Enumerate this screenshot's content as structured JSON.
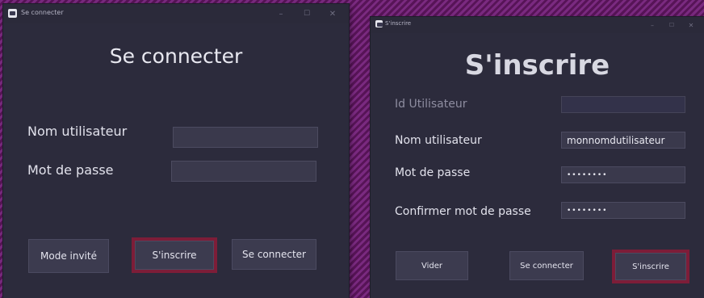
{
  "login_window": {
    "title": "Se connecter",
    "heading": "Se connecter",
    "username_label": "Nom utilisateur",
    "username_value": "",
    "password_label": "Mot de passe",
    "password_value": "",
    "guest_button": "Mode invité",
    "register_button": "S'inscrire",
    "login_button": "Se connecter",
    "controls": {
      "minimize": "–",
      "maximize": "☐",
      "close": "✕"
    }
  },
  "register_window": {
    "title": "S'inscrire",
    "heading": "S'inscrire",
    "userid_label": "Id Utilisateur",
    "userid_value": "",
    "username_label": "Nom utilisateur",
    "username_value": "monnomdutilisateur",
    "password_label": "Mot de passe",
    "password_value": "••••••••",
    "confirm_label": "Confirmer mot de passe",
    "confirm_value": "••••••••",
    "clear_button": "Vider",
    "login_button": "Se connecter",
    "register_button": "S'inscrire",
    "controls": {
      "minimize": "–",
      "maximize": "☐",
      "close": "✕"
    }
  },
  "colors": {
    "window_bg": "#2c2b3c",
    "field_bg": "#3a394c",
    "button_bg": "#3c3b4f",
    "highlight": "#7d1d38",
    "desktop": "#6a1e6e"
  }
}
